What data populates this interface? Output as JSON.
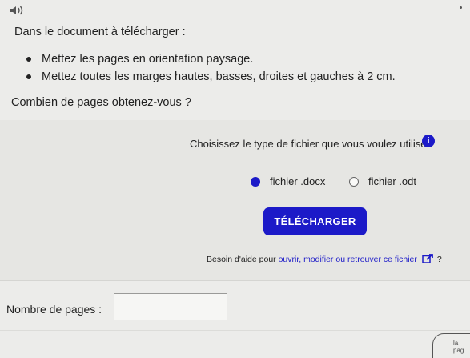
{
  "intro": "Dans le document à télécharger :",
  "bullets": [
    "Mettez les pages en orientation paysage.",
    "Mettez toutes les marges hautes, basses, droites et gauches à 2 cm."
  ],
  "question": "Combien de pages obtenez-vous ?",
  "file_type": {
    "prompt": "Choisissez le type de fichier que vous voulez utiliser",
    "info_icon": "i",
    "options": [
      {
        "label": "fichier .docx",
        "selected": true
      },
      {
        "label": "fichier .odt",
        "selected": false
      }
    ]
  },
  "download_button": "TÉLÉCHARGER",
  "help": {
    "prefix": "Besoin d'aide pour ",
    "link": "ouvrir, modifier ou retrouver ce fichier",
    "suffix": " ?"
  },
  "answer": {
    "label": "Nombre de pages :",
    "value": ""
  },
  "corner_text": "la pag",
  "colors": {
    "accent": "#1c1ac8",
    "background": "#ececea"
  }
}
